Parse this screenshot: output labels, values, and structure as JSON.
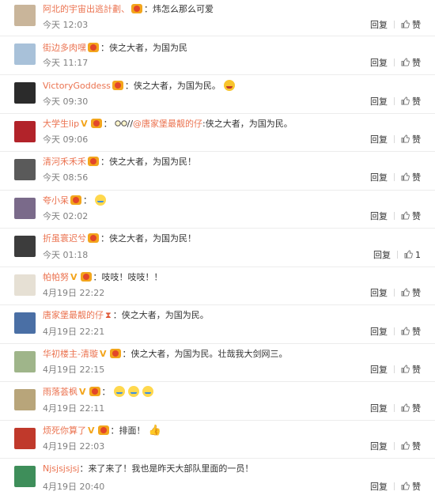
{
  "actions": {
    "reply": "回复",
    "like": "赞"
  },
  "comments": [
    {
      "username": "阿北的宇宙出逃計劃、",
      "separator": "：",
      "text": "炜怎么那么可爱",
      "time": "今天 12:03",
      "like_count": "",
      "avatar_color": "#c9b59a"
    },
    {
      "username": "街边多肉嘿",
      "separator": "：",
      "text": "侠之大者，为国为民",
      "time": "今天 11:17",
      "like_count": "",
      "avatar_color": "#a8c1d9"
    },
    {
      "username": "VictoryGoddess",
      "separator": "：",
      "text": "侠之大者，为国为民。",
      "time": "今天 09:30",
      "like_count": "",
      "avatar_color": "#2b2b2b"
    },
    {
      "username": "大学生lip",
      "separator": "：",
      "text": "//",
      "mention": "@唐家堡最靓的仔",
      "text2": ":侠之大者，为国为民。",
      "time": "今天 09:06",
      "like_count": "",
      "avatar_color": "#b2232a"
    },
    {
      "username": "清河禾禾禾",
      "separator": "：",
      "text": "侠之大者，为国为民！",
      "time": "今天 08:56",
      "like_count": "",
      "avatar_color": "#5a5a5a"
    },
    {
      "username": "夸小呆",
      "separator": "：",
      "text": "",
      "time": "今天 02:02",
      "like_count": "",
      "avatar_color": "#7a6a8a"
    },
    {
      "username": "折虽寰迟兮",
      "separator": "：",
      "text": "侠之大者，为国为民！",
      "time": "今天 01:18",
      "like_count": "1",
      "avatar_color": "#3c3c3c"
    },
    {
      "username": "帕帕努",
      "separator": "：",
      "text": "吱吱！吱吱！！",
      "time": "4月19日 22:22",
      "like_count": "",
      "avatar_color": "#e6e0d4"
    },
    {
      "username": "唐家堡最靓的仔",
      "separator": "：",
      "text": "侠之大者，为国为民。",
      "time": "4月19日 22:21",
      "like_count": "",
      "avatar_color": "#4a6fa5"
    },
    {
      "username": "华初楼主-清璇",
      "separator": "：",
      "text": "侠之大者，为国为民。壮哉我大剑网三。",
      "time": "4月19日 22:15",
      "like_count": "",
      "avatar_color": "#9fb58a"
    },
    {
      "username": "雨落荟枫",
      "separator": "：",
      "text": "",
      "time": "4月19日 22:11",
      "like_count": "",
      "avatar_color": "#b8a57a"
    },
    {
      "username": "烦死你算了",
      "separator": "：",
      "text": "排面！",
      "time": "4月19日 22:03",
      "like_count": "",
      "avatar_color": "#c0392b"
    },
    {
      "username": "Njsjsjsjsj",
      "separator": "：",
      "text": "来了来了！我也是昨天大部队里面的一员！",
      "time": "4月19日 20:40",
      "like_count": "",
      "avatar_color": "#3e8e5a"
    }
  ]
}
